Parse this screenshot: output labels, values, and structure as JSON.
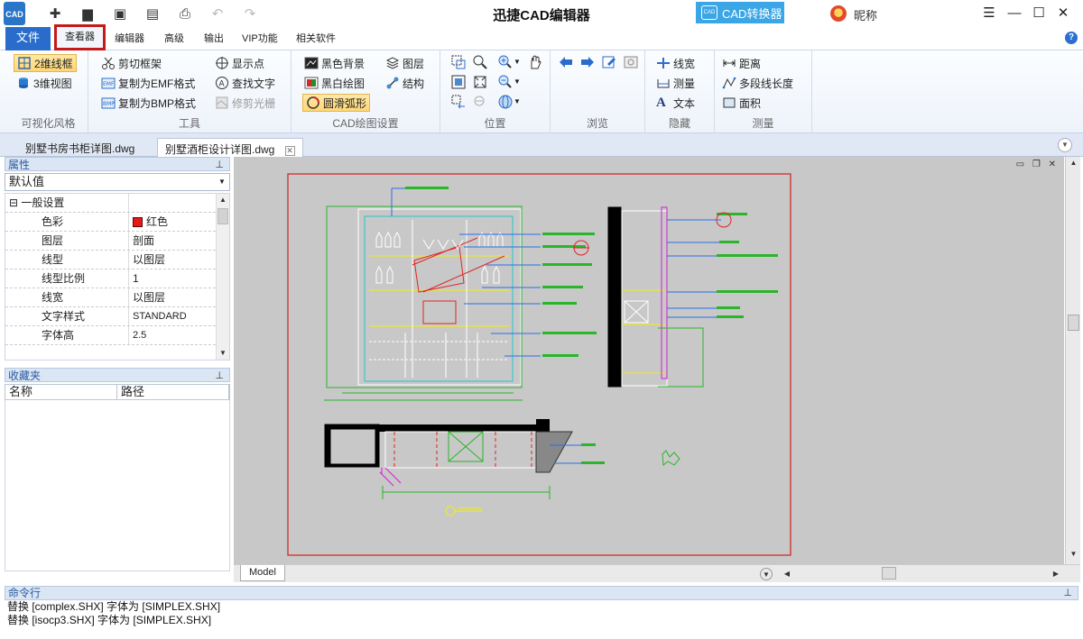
{
  "app": {
    "logo_text": "CAD",
    "title": "迅捷CAD编辑器",
    "converter_label": "CAD转换器",
    "converter_icon_text": "CAD",
    "user_name": "昵称"
  },
  "window_controls": {
    "menu": "☰",
    "minimize": "—",
    "maximize": "☐",
    "close": "✕"
  },
  "menu": {
    "tabs": [
      "文件",
      "查看器",
      "编辑器",
      "高级",
      "输出",
      "VIP功能",
      "相关软件"
    ],
    "active": "查看器"
  },
  "ribbon": {
    "groups": {
      "visual_style": {
        "label": "可视化风格",
        "btn_2d": "2维线框",
        "btn_3d": "3维视图"
      },
      "tools": {
        "label": "工具",
        "clip_frame": "剪切框架",
        "copy_emf": "复制为EMF格式",
        "copy_bmp": "复制为BMP格式",
        "show_points": "显示点",
        "find_text": "查找文字",
        "trim_raster": "修剪光栅"
      },
      "cad_draw": {
        "label": "CAD绘图设置",
        "black_bg": "黑色背景",
        "bw_draw": "黑白绘图",
        "smooth_arc": "圆滑弧形",
        "layers": "图层",
        "structure": "结构"
      },
      "position": {
        "label": "位置"
      },
      "browse": {
        "label": "浏览"
      },
      "hide": {
        "label": "隐藏",
        "line_width": "线宽",
        "measure": "测量",
        "text": "文本"
      },
      "measure": {
        "label": "测量",
        "distance": "距离",
        "polyline_length": "多段线长度",
        "area": "面积"
      }
    }
  },
  "doc_tabs": [
    {
      "label": "别墅书房书柜详图.dwg",
      "active": false
    },
    {
      "label": "别墅酒柜设计详图.dwg",
      "active": true
    }
  ],
  "properties": {
    "header": "属性",
    "dropdown_value": "默认值",
    "section": "一般设置",
    "rows": [
      {
        "key": "色彩",
        "value": "红色"
      },
      {
        "key": "图层",
        "value": "剖面"
      },
      {
        "key": "线型",
        "value": "以图层"
      },
      {
        "key": "线型比例",
        "value": "1"
      },
      {
        "key": "线宽",
        "value": "以图层"
      },
      {
        "key": "文字样式",
        "value": "STANDARD"
      },
      {
        "key": "字体高",
        "value": "2.5"
      }
    ],
    "color_hex": "#e41a1a"
  },
  "favorites": {
    "header": "收藏夹",
    "col_name": "名称",
    "col_path": "路径"
  },
  "model_tab": "Model",
  "command": {
    "header": "命令行",
    "lines": [
      "替换 [complex.SHX] 字体为 [SIMPLEX.SHX]",
      "替换 [isocp3.SHX] 字体为 [SIMPLEX.SHX]"
    ]
  },
  "colors": {
    "accent": "#2a6ccb",
    "highlight_border": "#c51a1a",
    "canvas": "#c8c8c8"
  }
}
